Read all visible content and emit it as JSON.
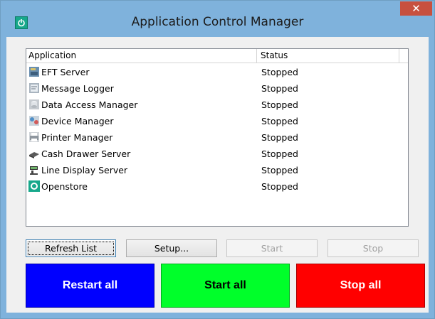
{
  "window": {
    "title": "Application Control Manager",
    "close_glyph": "✕"
  },
  "list": {
    "columns": [
      "Application",
      "Status"
    ],
    "rows": [
      {
        "name": "EFT Server",
        "status": "Stopped",
        "icon": "server-icon"
      },
      {
        "name": "Message Logger",
        "status": "Stopped",
        "icon": "logger-icon"
      },
      {
        "name": "Data Access Manager",
        "status": "Stopped",
        "icon": "database-icon"
      },
      {
        "name": "Device Manager",
        "status": "Stopped",
        "icon": "device-icon"
      },
      {
        "name": "Printer Manager",
        "status": "Stopped",
        "icon": "printer-icon"
      },
      {
        "name": "Cash Drawer Server",
        "status": "Stopped",
        "icon": "cash-drawer-icon"
      },
      {
        "name": "Line Display Server",
        "status": "Stopped",
        "icon": "line-display-icon"
      },
      {
        "name": "Openstore",
        "status": "Stopped",
        "icon": "openstore-icon"
      }
    ]
  },
  "buttons": {
    "refresh": "Refresh List",
    "setup": "Setup...",
    "start": "Start",
    "stop": "Stop",
    "restart_all": "Restart all",
    "start_all": "Start all",
    "stop_all": "Stop all"
  },
  "colors": {
    "titlebar": "#7fb2dc",
    "restart_all": "#0000ff",
    "start_all": "#00ff2a",
    "stop_all": "#ff0000",
    "openstore": "#17a88b"
  }
}
